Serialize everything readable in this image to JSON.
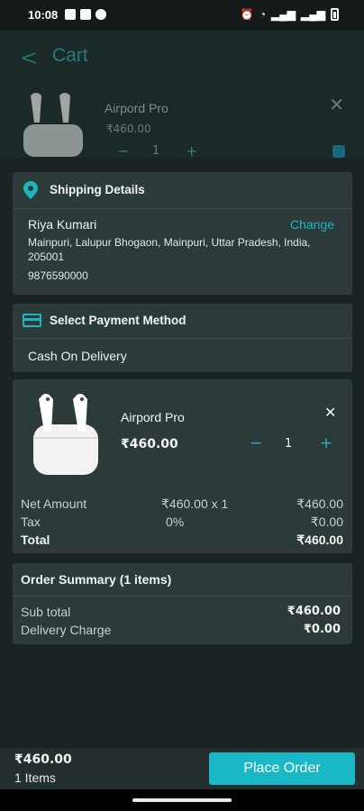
{
  "status_bar": {
    "time": "10:08",
    "right_icons": "⏰ ☎ᵏ ▴ .ıl .ıl"
  },
  "background": {
    "title": "Cart",
    "item_name": "Airpord Pro",
    "item_price": "₹460.00",
    "qty": "1"
  },
  "shipping": {
    "title": "Shipping Details",
    "name": "Riya Kumari",
    "change_label": "Change",
    "address": "Mainpuri, Lalupur Bhogaon, Mainpuri, Uttar Pradesh, India, 205001",
    "phone": "9876590000"
  },
  "payment": {
    "title": "Select Payment Method",
    "method": "Cash On Delivery"
  },
  "item": {
    "name": "Airpord Pro",
    "price": "₹460.00",
    "qty": "1",
    "rows": [
      {
        "label": "Net Amount",
        "calc": "₹460.00 x 1",
        "value": "₹460.00"
      },
      {
        "label": "Tax",
        "calc": "0%",
        "value": "₹0.00"
      },
      {
        "label": "Total",
        "calc": "",
        "value": "₹460.00"
      }
    ]
  },
  "summary": {
    "title": "Order Summary (1 items)",
    "subtotal_label": "Sub total",
    "subtotal_value": "₹460.00",
    "delivery_label": "Delivery Charge",
    "delivery_value": "₹0.00"
  },
  "bottom": {
    "total": "₹460.00",
    "count": "1 Items",
    "button_label": "Place Order"
  },
  "colors": {
    "accent": "#1ab8c6",
    "card": "#2c3a39",
    "sheet": "#1b2424"
  }
}
